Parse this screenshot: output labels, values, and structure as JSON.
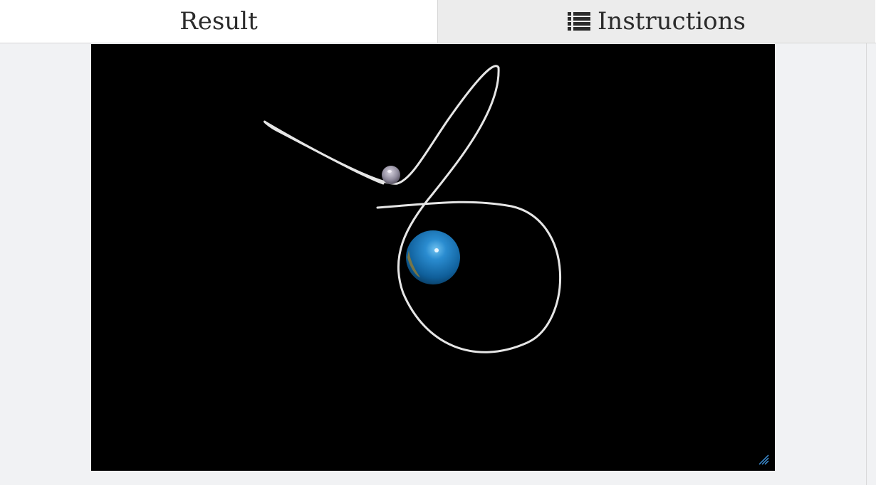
{
  "tabs": {
    "result_label": "Result",
    "instructions_label": "Instructions",
    "instructions_icon": "list-icon"
  },
  "scene": {
    "background_color": "#000000",
    "orbit_color": "#e8e8e8",
    "planet": {
      "icon": "blue-planet-sphere",
      "color": "#1a78b8"
    },
    "moon": {
      "icon": "small-grey-moon-sphere",
      "color": "#9a97a8"
    }
  },
  "resize_handle": {
    "icon": "resize-grip-icon",
    "color": "#3d8fd6"
  }
}
